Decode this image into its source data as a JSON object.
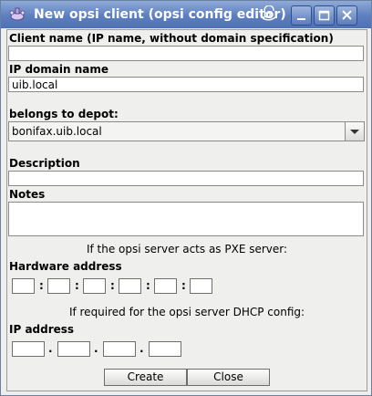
{
  "window": {
    "title": "New opsi client (opsi config editor)"
  },
  "form": {
    "client_name_label": "Client name (IP name, without domain specification)",
    "client_name_value": "",
    "domain_label": "IP domain name",
    "domain_value": "uib.local",
    "depot_label": "belongs to depot:",
    "depot_value": "bonifax.uib.local",
    "description_label": "Description",
    "description_value": "",
    "notes_label": "Notes",
    "notes_value": "",
    "pxe_hint": "If the opsi server acts as PXE server:",
    "hardware_label": "Hardware address",
    "mac_separator": ":",
    "dhcp_hint": "If required for the opsi server DHCP config:",
    "ip_label": "IP address",
    "ip_separator": "."
  },
  "buttons": {
    "create": "Create",
    "close": "Close"
  },
  "icons": {
    "app": "opsi-app-icon",
    "swirl": "window-menu-swirl-icon",
    "minimize": "minimize-icon",
    "maximize": "maximize-icon",
    "close": "close-icon",
    "dropdown": "chevron-down-icon"
  },
  "colors": {
    "titlebar": "#5d7fbf",
    "background": "#eeeeec"
  }
}
